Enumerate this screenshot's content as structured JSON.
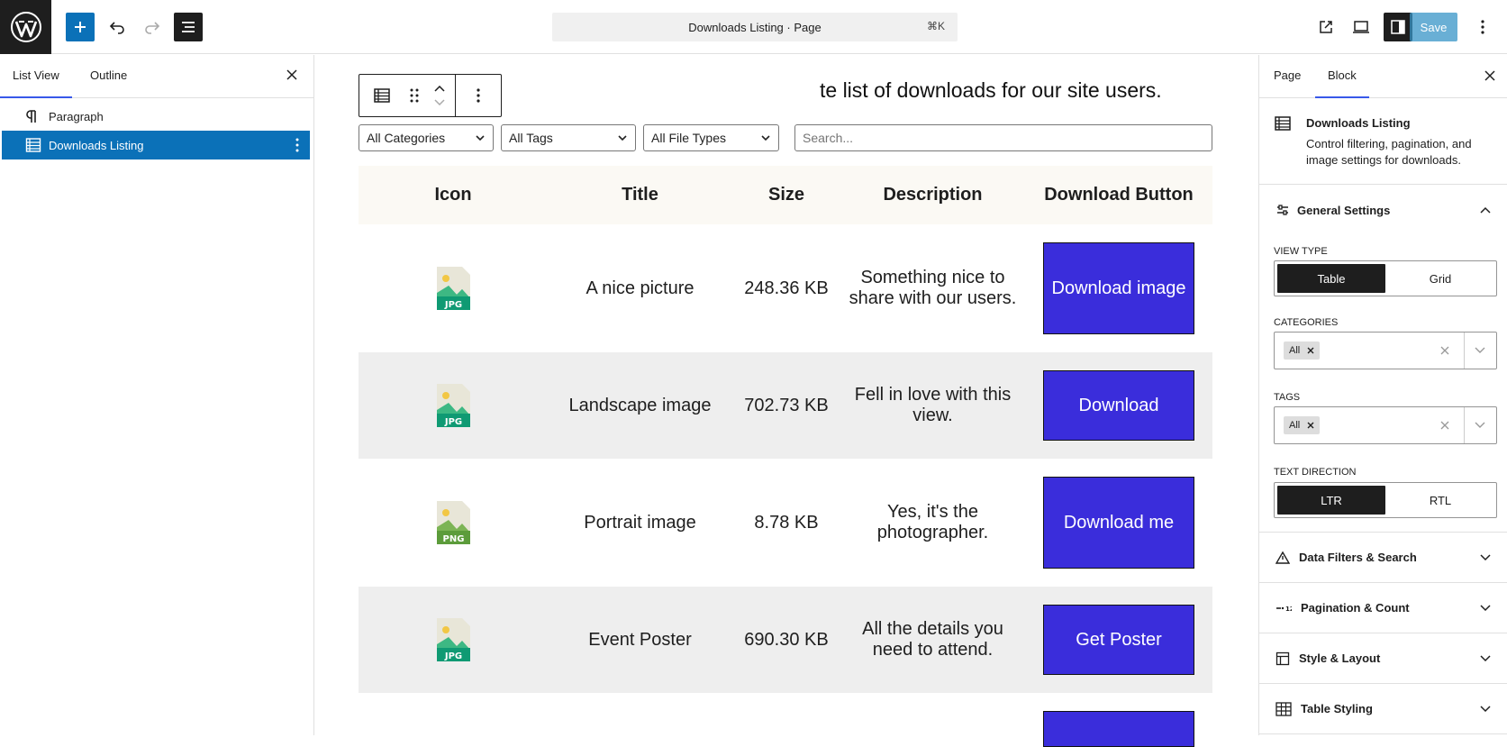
{
  "topbar": {
    "document_title": "Downloads Listing · Page",
    "shortcut": "⌘K",
    "save_label": "Save"
  },
  "left_panel": {
    "tabs": [
      {
        "label": "List View",
        "active": true
      },
      {
        "label": "Outline",
        "active": false
      }
    ],
    "items": [
      {
        "label": "Paragraph",
        "icon": "paragraph-icon",
        "selected": false
      },
      {
        "label": "Downloads Listing",
        "icon": "table-list-icon",
        "selected": true
      }
    ]
  },
  "canvas": {
    "intro_text": "te list of downloads for our site users.",
    "filters": {
      "categories": "All Categories",
      "tags": "All Tags",
      "file_types": "All File Types",
      "search_placeholder": "Search..."
    },
    "table": {
      "headers": [
        "Icon",
        "Title",
        "Size",
        "Description",
        "Download Button"
      ],
      "rows": [
        {
          "icon_type": "JPG",
          "title": "A nice picture",
          "size": "248.36 KB",
          "description": "Something nice to share with our users.",
          "button": "Download image"
        },
        {
          "icon_type": "JPG",
          "title": "Landscape image",
          "size": "702.73 KB",
          "description": "Fell in love with this view.",
          "button": "Download"
        },
        {
          "icon_type": "PNG",
          "title": "Portrait image",
          "size": "8.78 KB",
          "description": "Yes, it's the photographer.",
          "button": "Download me"
        },
        {
          "icon_type": "JPG",
          "title": "Event Poster",
          "size": "690.30 KB",
          "description": "All the details you need to attend.",
          "button": "Get Poster"
        }
      ]
    }
  },
  "right_panel": {
    "tabs": [
      {
        "label": "Page",
        "active": false
      },
      {
        "label": "Block",
        "active": true
      }
    ],
    "block": {
      "name": "Downloads Listing",
      "description": "Control filtering, pagination, and image settings for downloads."
    },
    "general_settings": {
      "title": "General Settings",
      "view_type_label": "View Type",
      "view_type_options": [
        "Table",
        "Grid"
      ],
      "view_type_selected": "Table",
      "categories_label": "Categories",
      "categories_chip": "All",
      "tags_label": "Tags",
      "tags_chip": "All",
      "text_direction_label": "Text Direction",
      "text_direction_options": [
        "LTR",
        "RTL"
      ],
      "text_direction_selected": "LTR"
    },
    "collapsed_panels": [
      {
        "title": "Data Filters & Search",
        "icon": "warning-triangle-icon"
      },
      {
        "title": "Pagination & Count",
        "icon": "pagination-icon"
      },
      {
        "title": "Style & Layout",
        "icon": "layout-icon"
      },
      {
        "title": "Table Styling",
        "icon": "table-icon"
      }
    ]
  },
  "colors": {
    "accent": "#0b71b8",
    "download_button": "#3a2ddb",
    "tab_indicator": "#3858e9",
    "dark": "#1e1e1e"
  }
}
